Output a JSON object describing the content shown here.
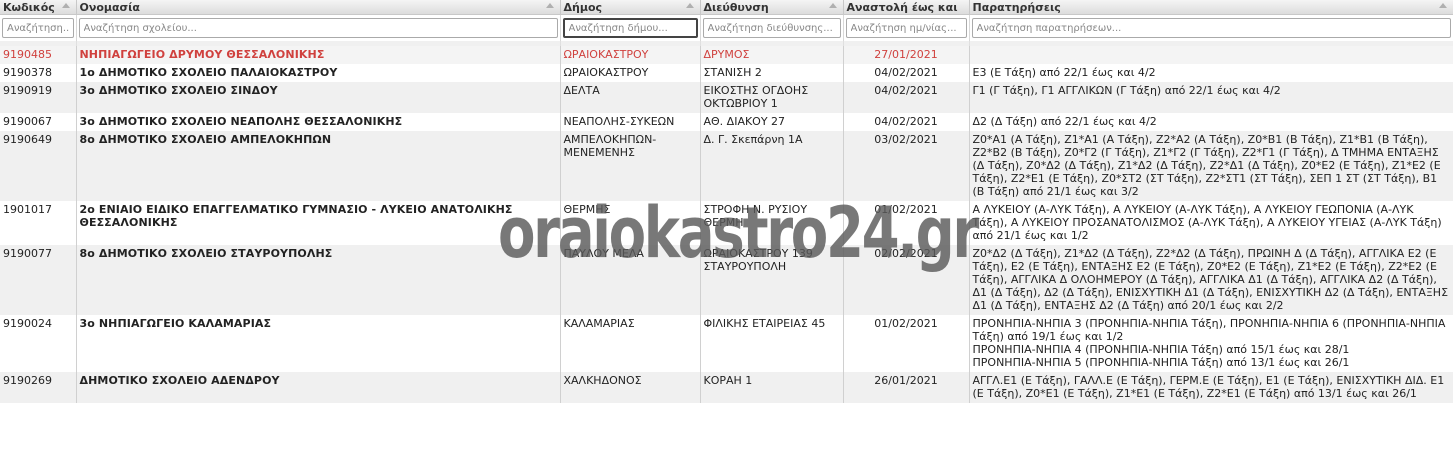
{
  "columns": [
    {
      "label": "Κωδικός",
      "placeholder": "Αναζήτηση..."
    },
    {
      "label": "Ονομασία",
      "placeholder": "Αναζήτηση σχολείου..."
    },
    {
      "label": "Δήμος",
      "placeholder": "Αναζήτηση δήμου..."
    },
    {
      "label": "Διεύθυνση",
      "placeholder": "Αναζήτηση διεύθυνσης..."
    },
    {
      "label": "Αναστολή έως και",
      "placeholder": "Αναζήτηση ημ/νίας..."
    },
    {
      "label": "Παρατηρήσεις",
      "placeholder": "Αναζήτηση παρατηρήσεων..."
    }
  ],
  "rows": [
    {
      "code": "9190485",
      "name": "ΝΗΠΙΑΓΩΓΕΙΟ ΔΡΥΜΟΥ ΘΕΣΣΑΛΟΝΙΚΗΣ",
      "municipality": "ΩΡΑΙΟΚΑΣΤΡΟΥ",
      "address": "ΔΡΥΜΟΣ",
      "date": "27/01/2021",
      "notes": "",
      "highlight": true
    },
    {
      "code": "9190378",
      "name": "1ο ΔΗΜΟΤΙΚΟ ΣΧΟΛΕΙΟ ΠΑΛΑΙΟΚΑΣΤΡΟΥ",
      "municipality": "ΩΡΑΙΟΚΑΣΤΡΟΥ",
      "address": "ΣΤΑΝΙΣΗ 2",
      "date": "04/02/2021",
      "notes": "Ε3 (Ε Τάξη) από 22/1 έως και 4/2"
    },
    {
      "code": "9190919",
      "name": "3ο ΔΗΜΟΤΙΚΟ ΣΧΟΛΕΙΟ ΣΙΝΔΟΥ",
      "municipality": "ΔΕΛΤΑ",
      "address": "ΕΙΚΟΣΤΗΣ ΟΓΔΟΗΣ ΟΚΤΩΒΡΙΟΥ 1",
      "date": "04/02/2021",
      "notes": "Γ1 (Γ Τάξη), Γ1 ΑΓΓΛΙΚΩΝ (Γ Τάξη) από 22/1 έως και 4/2"
    },
    {
      "code": "9190067",
      "name": "3ο ΔΗΜΟΤΙΚΟ ΣΧΟΛΕΙΟ  ΝΕΑΠΟΛΗΣ ΘΕΣΣΑΛΟΝΙΚΗΣ",
      "municipality": "ΝΕΑΠΟΛΗΣ-ΣΥΚΕΩΝ",
      "address": "ΑΘ. ΔΙΑΚΟΥ 27",
      "date": "04/02/2021",
      "notes": "Δ2 (Δ Τάξη) από 22/1 έως και 4/2"
    },
    {
      "code": "9190649",
      "name": "8ο ΔΗΜΟΤΙΚΟ ΣΧΟΛΕΙΟ ΑΜΠΕΛΟΚΗΠΩΝ",
      "municipality": "ΑΜΠΕΛΟΚΗΠΩΝ-ΜΕΝΕΜΕΝΗΣ",
      "address": "Δ. Γ. Σκεπάρνη 1Α",
      "date": "03/02/2021",
      "notes": "Ζ0*Α1 (Α Τάξη), Ζ1*Α1 (Α Τάξη), Ζ2*Α2 (Α Τάξη), Ζ0*Β1 (Β Τάξη), Ζ1*Β1 (Β Τάξη), Ζ2*Β2 (Β Τάξη), Ζ0*Γ2 (Γ Τάξη), Ζ1*Γ2 (Γ Τάξη), Ζ2*Γ1 (Γ Τάξη), Δ ΤΜΗΜΑ ΕΝΤΑΞΗΣ (Δ Τάξη), Ζ0*Δ2 (Δ Τάξη), Ζ1*Δ2 (Δ Τάξη), Ζ2*Δ1 (Δ Τάξη), Ζ0*Ε2 (Ε Τάξη), Ζ1*Ε2 (Ε Τάξη), Ζ2*Ε1 (Ε Τάξη), Ζ0*ΣΤ2 (ΣΤ Τάξη), Ζ2*ΣΤ1 (ΣΤ Τάξη), ΣΕΠ 1 ΣΤ (ΣΤ Τάξη), Β1 (Β Τάξη) από 21/1 έως και 3/2"
    },
    {
      "code": "1901017",
      "name": "2ο  ΕΝΙΑΙΟ  ΕΙΔΙΚΟ ΕΠΑΓΓΕΛΜΑΤΙΚΟ ΓΥΜΝΑΣΙΟ - ΛΥΚΕΙΟ ΑΝΑΤΟΛΙΚΗΣ ΘΕΣΣΑΛΟΝΙΚΗΣ",
      "municipality": "ΘΕΡΜΗΣ",
      "address": "ΣΤΡΟΦΗ Ν. ΡΥΣΙΟΥ ΘΕΡΜΗ",
      "date": "01/02/2021",
      "notes": "Α  ΛΥΚΕΙΟΥ (Α-ΛΥΚ Τάξη), Α ΛΥΚΕΙΟΥ (Α-ΛΥΚ Τάξη), Α ΛΥΚΕΙΟΥ  ΓΕΩΠΟΝΙΑ (Α-ΛΥΚ Τάξη), Α ΛΥΚΕΙΟΥ ΠΡΟΣΑΝΑΤΟΛΙΣΜΟΣ (Α-ΛΥΚ Τάξη), Α ΛΥΚΕΙΟΥ ΥΓΕΙΑΣ (Α-ΛΥΚ Τάξη) από 21/1 έως και 1/2"
    },
    {
      "code": "9190077",
      "name": "8ο ΔΗΜΟΤΙΚΟ ΣΧΟΛΕΙΟ ΣΤΑΥΡΟΥΠΟΛΗΣ",
      "municipality": "ΠΑΥΛΟΥ ΜΕΛΑ",
      "address": "ΩΡΑΙΟΚΑΣΤΡΟΥ 139 ΣΤΑΥΡΟΥΠΟΛΗ",
      "date": "02/02/2021",
      "notes": "Ζ0*Δ2 (Δ Τάξη), Ζ1*Δ2 (Δ Τάξη), Ζ2*Δ2 (Δ Τάξη), ΠΡΩΙΝΗ Δ (Δ Τάξη), ΑΓΓΛΙΚΑ Ε2 (Ε Τάξη), Ε2 (Ε Τάξη), ΕΝΤΑΞΗΣ Ε2 (Ε Τάξη), Ζ0*Ε2 (Ε Τάξη), Ζ1*Ε2 (Ε Τάξη), Ζ2*Ε2 (Ε Τάξη), ΑΓΓΛΙΚΑ Δ ΟΛΟΗΜΕΡΟΥ (Δ Τάξη), ΑΓΓΛΙΚΑ Δ1 (Δ Τάξη), ΑΓΓΛΙΚΑ Δ2 (Δ Τάξη), Δ1 (Δ Τάξη), Δ2 (Δ Τάξη), ΕΝΙΣΧΥΤΙΚΗ Δ1 (Δ Τάξη), ΕΝΙΣΧΥΤΙΚΗ Δ2 (Δ Τάξη), ΕΝΤΑΞΗΣ Δ1 (Δ Τάξη), ΕΝΤΑΞΗΣ Δ2 (Δ Τάξη) από 20/1 έως και 2/2"
    },
    {
      "code": "9190024",
      "name": "3ο ΝΗΠΙΑΓΩΓΕΙΟ ΚΑΛΑΜΑΡΙΑΣ",
      "municipality": "ΚΑΛΑΜΑΡΙΑΣ",
      "address": "ΦΙΛΙΚΗΣ ΕΤΑΙΡΕΙΑΣ 45",
      "date": "01/02/2021",
      "notes": "ΠΡΟΝΗΠΙΑ-ΝΗΠΙΑ 3 (ΠΡΟΝΗΠΙΑ-ΝΗΠΙΑ Τάξη), ΠΡΟΝΗΠΙΑ-ΝΗΠΙΑ 6 (ΠΡΟΝΗΠΙΑ-ΝΗΠΙΑ Τάξη) από 19/1 έως και 1/2\nΠΡΟΝΗΠΙΑ-ΝΗΠΙΑ 4 (ΠΡΟΝΗΠΙΑ-ΝΗΠΙΑ Τάξη) από 15/1 έως και 28/1\nΠΡΟΝΗΠΙΑ-ΝΗΠΙΑ 5 (ΠΡΟΝΗΠΙΑ-ΝΗΠΙΑ Τάξη) από 13/1 έως και 26/1"
    },
    {
      "code": "9190269",
      "name": "ΔΗΜΟΤΙΚΟ ΣΧΟΛΕΙΟ ΑΔΕΝΔΡΟΥ",
      "municipality": "ΧΑΛΚΗΔΟΝΟΣ",
      "address": "ΚΟΡΑΗ 1",
      "date": "26/01/2021",
      "notes": "ΑΓΓΛ.Ε1 (Ε Τάξη), ΓΑΛΛ.Ε (Ε Τάξη), ΓΕΡΜ.Ε (Ε Τάξη), Ε1 (Ε Τάξη), ΕΝΙΣΧΥΤΙΚΗ ΔΙΔ. Ε1 (Ε Τάξη), Ζ0*Ε1 (Ε Τάξη), Ζ1*Ε1 (Ε Τάξη), Ζ2*Ε1 (Ε Τάξη) από 13/1 έως και 26/1"
    }
  ],
  "watermark": "oraiokastro24.gr",
  "colors": {
    "highlight_text": "#d0413e",
    "alt_row": "#f0f0f0",
    "header_bg": "#e6e6e6"
  }
}
